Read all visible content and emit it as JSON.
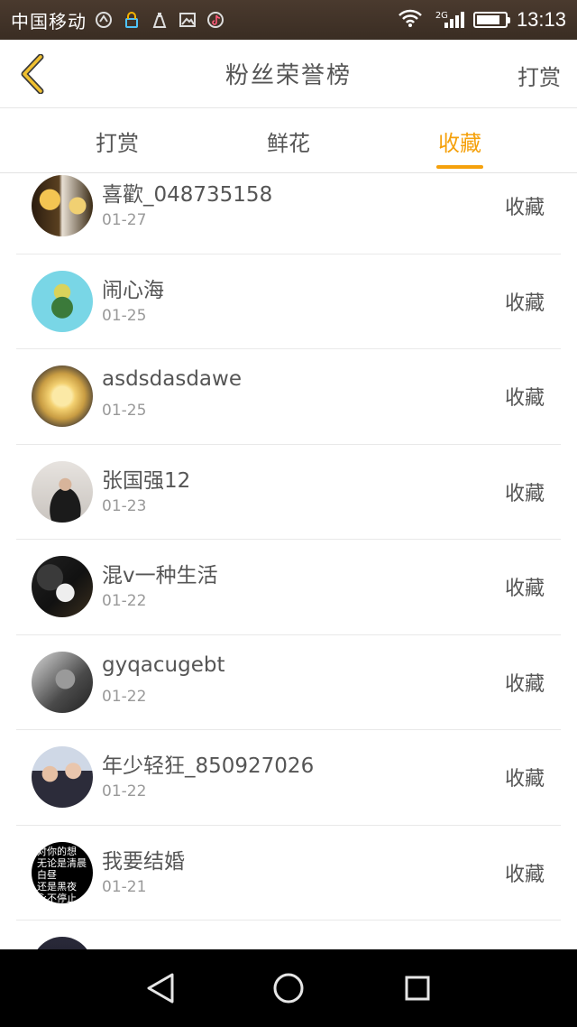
{
  "status_bar": {
    "carrier": "中国移动",
    "network": "2G",
    "time": "13:13",
    "battery_level": 0.85,
    "signal_bars": 4
  },
  "header": {
    "title": "粉丝荣誉榜",
    "right_action": "打赏",
    "back_icon": "chevron-left-icon",
    "accent_color": "#f5a10c"
  },
  "tabs": [
    {
      "label": "打赏",
      "active": false
    },
    {
      "label": "鲜花",
      "active": false
    },
    {
      "label": "收藏",
      "active": true
    }
  ],
  "fans": [
    {
      "name": "喜歡_048735158",
      "date": "01-27",
      "action": "收藏"
    },
    {
      "name": "闹心海",
      "date": "01-25",
      "action": "收藏"
    },
    {
      "name": "asdsdasdawe",
      "date": "01-25",
      "action": "收藏"
    },
    {
      "name": "张国强12",
      "date": "01-23",
      "action": "收藏"
    },
    {
      "name": "混v一种生活",
      "date": "01-22",
      "action": "收藏"
    },
    {
      "name": "gyqacugebt",
      "date": "01-22",
      "action": "收藏"
    },
    {
      "name": "年少轻狂_850927026",
      "date": "01-22",
      "action": "收藏"
    },
    {
      "name": "我要结婚",
      "date": "01-21",
      "action": "收藏",
      "avatar_text": "对你的想\n无论是清晨\n白昼\n还是黑夜\n永不停止"
    }
  ],
  "nav_bar": {
    "back_icon": "triangle-back-icon",
    "home_icon": "circle-home-icon",
    "recents_icon": "square-recents-icon"
  }
}
